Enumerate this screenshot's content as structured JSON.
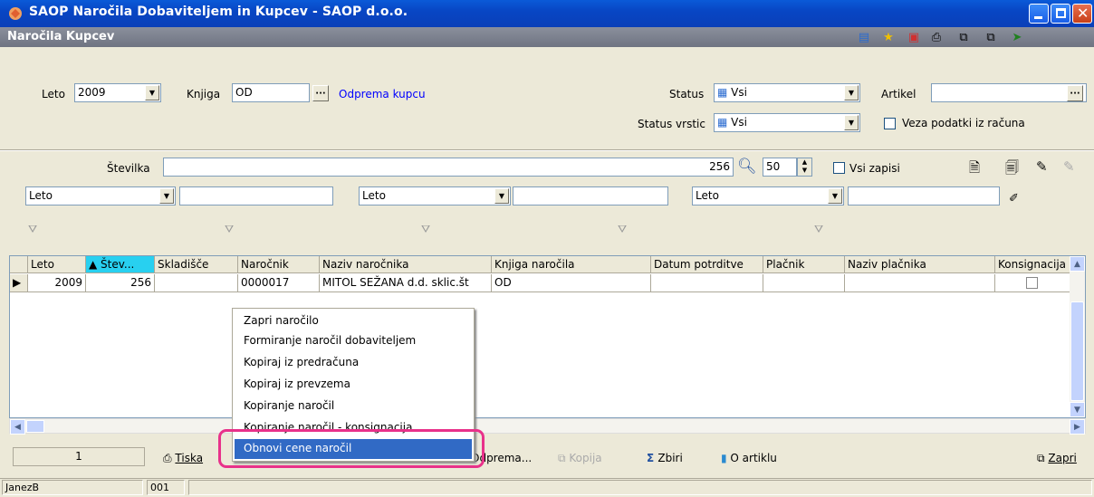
{
  "window": {
    "title": "SAOP  Naročila Dobaviteljem in Kupcev - SAOP d.o.o."
  },
  "header": {
    "title": "Naročila Kupcev"
  },
  "form": {
    "leto_label": "Leto",
    "leto_value": "2009",
    "knjiga_label": "Knjiga",
    "knjiga_value": "OD",
    "knjiga_link": "Odprema kupcu",
    "status_label": "Status",
    "status_value": "Vsi",
    "status_vrstic_label": "Status vrstic",
    "status_vrstic_value": "Vsi",
    "artikel_label": "Artikel",
    "artikel_value": "",
    "veza_label": "Veza podatki iz računa"
  },
  "search": {
    "stevilka_label": "Številka",
    "stevilka_value": "256",
    "limit_value": "50",
    "vsi_zapisi_label": "Vsi zapisi"
  },
  "filters": [
    "Leto",
    "Leto",
    "Leto"
  ],
  "grid": {
    "columns": [
      "Leto",
      "Štev...",
      "Skladišče",
      "Naročnik",
      "Naziv naročnika",
      "Knjiga naročila",
      "Datum potrditve",
      "Plačnik",
      "Naziv plačnika",
      "Konsignacija"
    ],
    "rows": [
      {
        "leto": "2009",
        "stev": "256",
        "skladisce": "",
        "narocnik": "0000017",
        "naziv": "MITOL SEŽANA d.d. sklic.št",
        "knjiga": "OD",
        "datum": "",
        "placnik": "",
        "naziv_placnika": ""
      }
    ]
  },
  "context_menu": {
    "items": [
      "Zapri naročilo",
      "Formiranje naročil dobaviteljem",
      "Kopiraj iz predračuna",
      "Kopiraj iz prevzema",
      "Kopiranje naročil",
      "Kopiranje naročil - konsignacija",
      "Obnovi cene naročil"
    ],
    "selected": "Obnovi cene naročil"
  },
  "bottom": {
    "count": "1",
    "tiskaj": "Tiska",
    "odprema": "Odprema...",
    "kopija": "Kopija",
    "zbirni": "Zbiri",
    "o_artiklu": "O artiklu",
    "zapri": "Zapri"
  },
  "status": {
    "user": "JanezB",
    "code": "001"
  },
  "colors": {
    "accent": "#316ac5",
    "highlight": "#e8318a",
    "title": "#0846c4"
  }
}
